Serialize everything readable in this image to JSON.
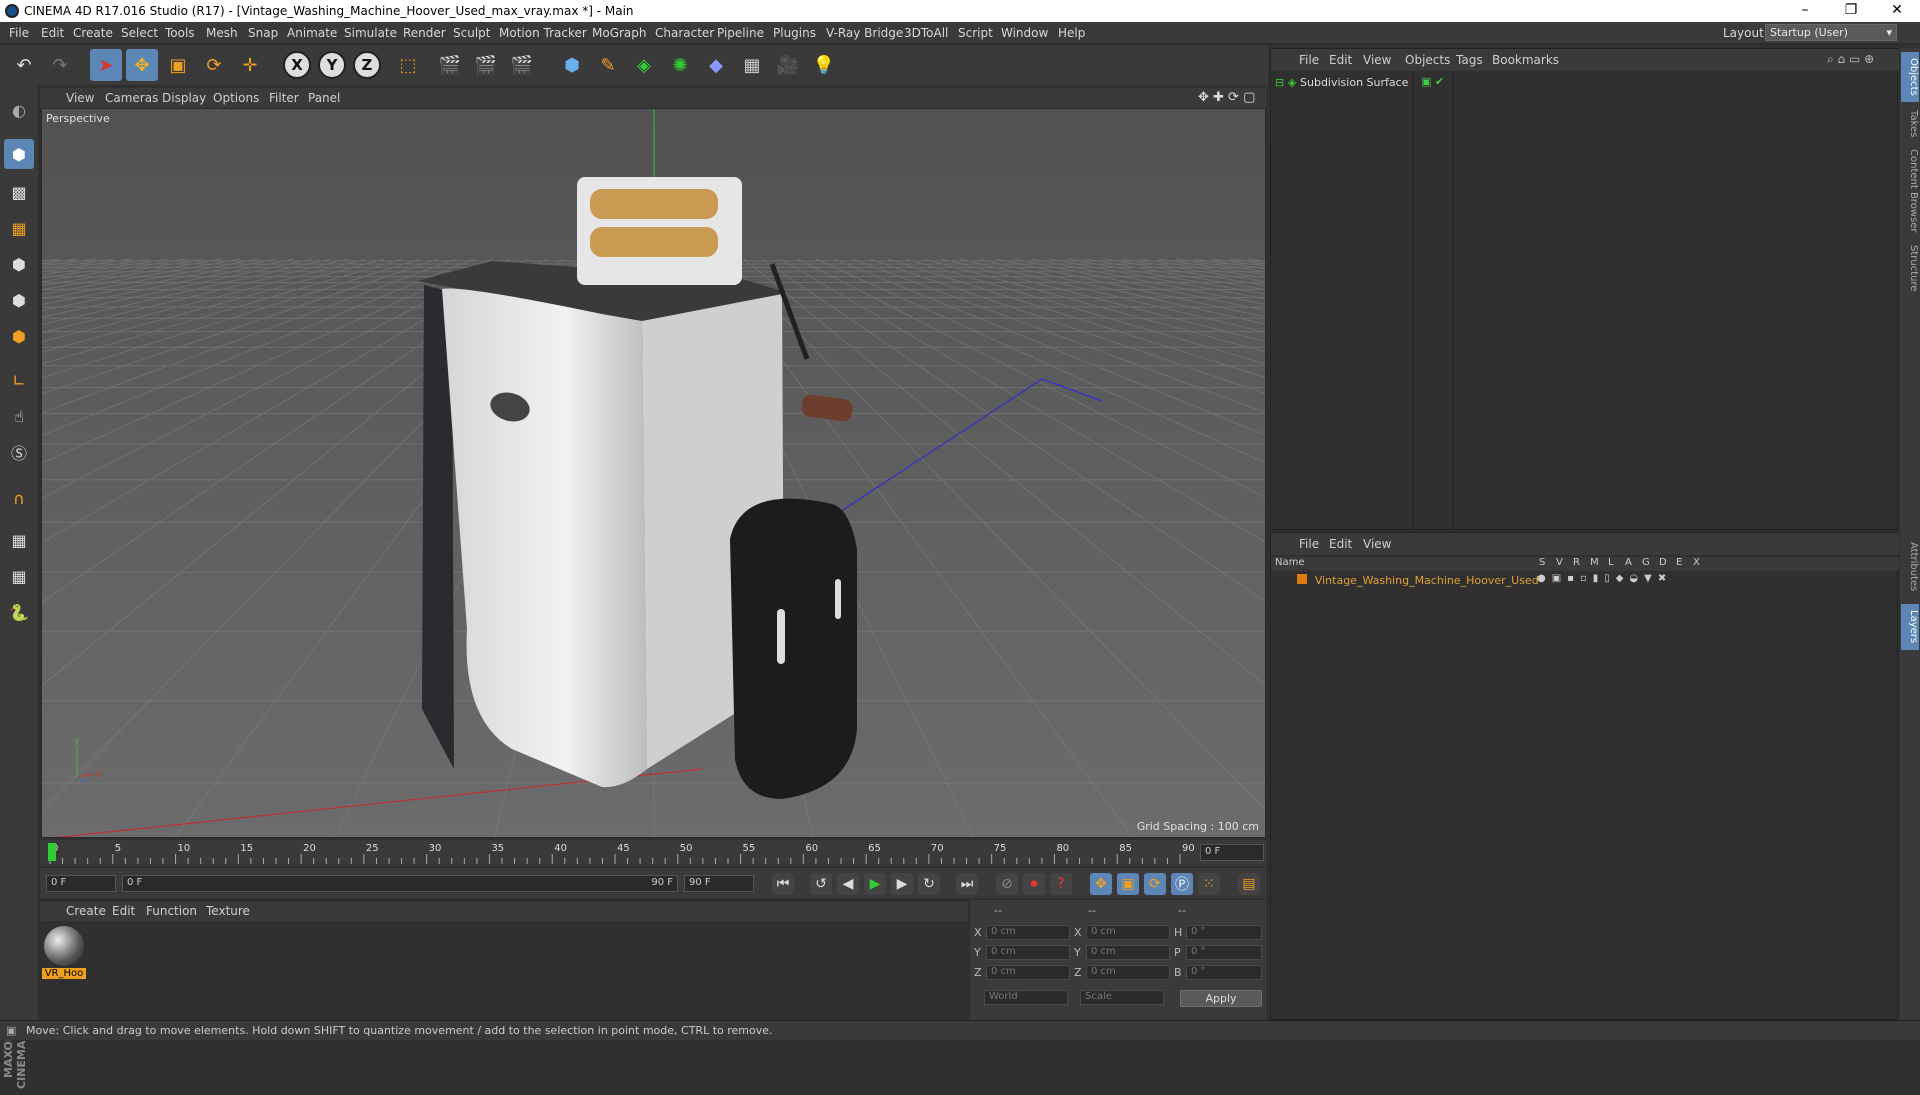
{
  "window": {
    "title": "CINEMA 4D R17.016 Studio (R17) - [Vintage_Washing_Machine_Hoover_Used_max_vray.max *] - Main",
    "controls": [
      "–",
      "❐",
      "✕"
    ]
  },
  "menu": {
    "items": [
      "File",
      "Edit",
      "Create",
      "Select",
      "Tools",
      "Mesh",
      "Snap",
      "Animate",
      "Simulate",
      "Render",
      "Sculpt",
      "Motion Tracker",
      "MoGraph",
      "Character",
      "Pipeline",
      "Plugins",
      "V-Ray Bridge",
      "3DToAll",
      "Script",
      "Window",
      "Help"
    ],
    "layout_label": "Layout:",
    "layout_value": "Startup (User)"
  },
  "viewport": {
    "menu": [
      "View",
      "Cameras",
      "Display",
      "Options",
      "Filter",
      "Panel"
    ],
    "camera_label": "Perspective",
    "grid_spacing": "Grid Spacing : 100 cm"
  },
  "timeline": {
    "ticks": [
      "0",
      "5",
      "10",
      "15",
      "20",
      "25",
      "30",
      "35",
      "40",
      "45",
      "50",
      "55",
      "60",
      "65",
      "70",
      "75",
      "80",
      "85",
      "90"
    ],
    "current_frame": "0 F",
    "start_field": "0 F",
    "range_start": "0 F",
    "range_end": "90 F",
    "end_field": "90 F"
  },
  "materials": {
    "menu": [
      "Create",
      "Edit",
      "Function",
      "Texture"
    ],
    "items": [
      {
        "label": "VR_Hoo"
      }
    ]
  },
  "coordinates": {
    "headers": [
      "--",
      "--",
      "--"
    ],
    "rows": [
      {
        "a": "X",
        "av": "0 cm",
        "b": "X",
        "bv": "0 cm",
        "c": "H",
        "cv": "0 °"
      },
      {
        "a": "Y",
        "av": "0 cm",
        "b": "Y",
        "bv": "0 cm",
        "c": "P",
        "cv": "0 °"
      },
      {
        "a": "Z",
        "av": "0 cm",
        "b": "Z",
        "bv": "0 cm",
        "c": "B",
        "cv": "0 °"
      }
    ],
    "mode1": "World",
    "mode2": "Scale",
    "apply": "Apply"
  },
  "objects": {
    "menu": [
      "File",
      "Edit",
      "View",
      "Objects",
      "Tags",
      "Bookmarks"
    ],
    "tree": [
      {
        "name": "Subdivision Surface"
      }
    ]
  },
  "layers": {
    "menu": [
      "File",
      "Edit",
      "View"
    ],
    "columns": [
      "Name",
      "S",
      "V",
      "R",
      "M",
      "L",
      "A",
      "G",
      "D",
      "E",
      "X"
    ],
    "rows": [
      {
        "name": "Vintage_Washing_Machine_Hoover_Used",
        "color": "#e07a10"
      }
    ]
  },
  "right_tabs": [
    "Objects",
    "Takes",
    "Content Browser",
    "Structure",
    "Attributes",
    "Layers"
  ],
  "brand": "MAXON CINEMA 4D",
  "status": "Move: Click and drag to move elements. Hold down SHIFT to quantize movement / add to the selection in point mode, CTRL to remove.",
  "colors": {
    "accent": "#5c86b5",
    "layer_text": "#e0a030"
  }
}
